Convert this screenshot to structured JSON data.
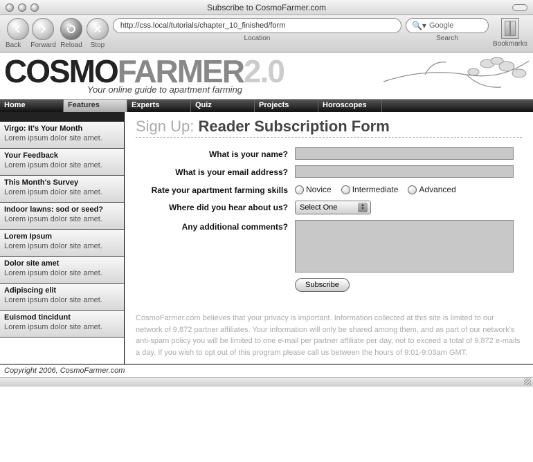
{
  "chrome": {
    "title": "Subscribe to CosmoFarmer.com",
    "back": "Back",
    "forward": "Forward",
    "reload": "Reload",
    "stop": "Stop",
    "location_label": "Location",
    "url": "http://css.local/tutorials/chapter_10_finished/form",
    "search_label": "Search",
    "search_placeholder": "Google",
    "bookmarks": "Bookmarks"
  },
  "branding": {
    "logo_cosmo": "COSMO",
    "logo_farmer": "FARMER",
    "logo_version": "2.0",
    "tagline": "Your online guide to apartment farming"
  },
  "nav": [
    "Home",
    "Features",
    "Experts",
    "Quiz",
    "Projects",
    "Horoscopes"
  ],
  "sidebar": [
    {
      "title": "Virgo: It's Your Month",
      "body": "Lorem ipsum dolor site amet."
    },
    {
      "title": "Your Feedback",
      "body": "Lorem ipsum dolor site amet."
    },
    {
      "title": "This Month's Survey",
      "body": "Lorem ipsum dolor site amet."
    },
    {
      "title": "Indoor lawns: sod or seed?",
      "body": "Lorem ipsum dolor site amet."
    },
    {
      "title": "Lorem Ipsum",
      "body": "Lorem ipsum dolor site amet."
    },
    {
      "title": "Dolor site amet",
      "body": "Lorem ipsum dolor site amet."
    },
    {
      "title": "Adipiscing elit",
      "body": "Lorem ipsum dolor site amet."
    },
    {
      "title": "Euismod tincidunt",
      "body": "Lorem ipsum dolor site amet."
    }
  ],
  "page_title": {
    "prefix": "Sign Up:",
    "main": "Reader Subscription Form"
  },
  "form": {
    "name_label": "What is your name?",
    "email_label": "What is your email address?",
    "skill_label": "Rate your apartment farming skills",
    "skill_options": [
      "Novice",
      "Intermediate",
      "Advanced"
    ],
    "source_label": "Where did you hear about us?",
    "source_select": "Select One",
    "comments_label": "Any additional comments?",
    "submit": "Subscribe"
  },
  "fineprint": "CosmoFarmer.com believes that your privacy is important. Information collected at this site is limited to our network of 9,872 partner affiliates. Your information will only be shared among them, and as part of our network's anti-spam policy you will be limited to one e-mail per partner affiliate per day, not to exceed a total of 9,872 e-mails a day. If you wish to opt out of this program please call us between the hours of 9:01-9:03am GMT.",
  "footer": "Copyright 2006, CosmoFarmer.com"
}
